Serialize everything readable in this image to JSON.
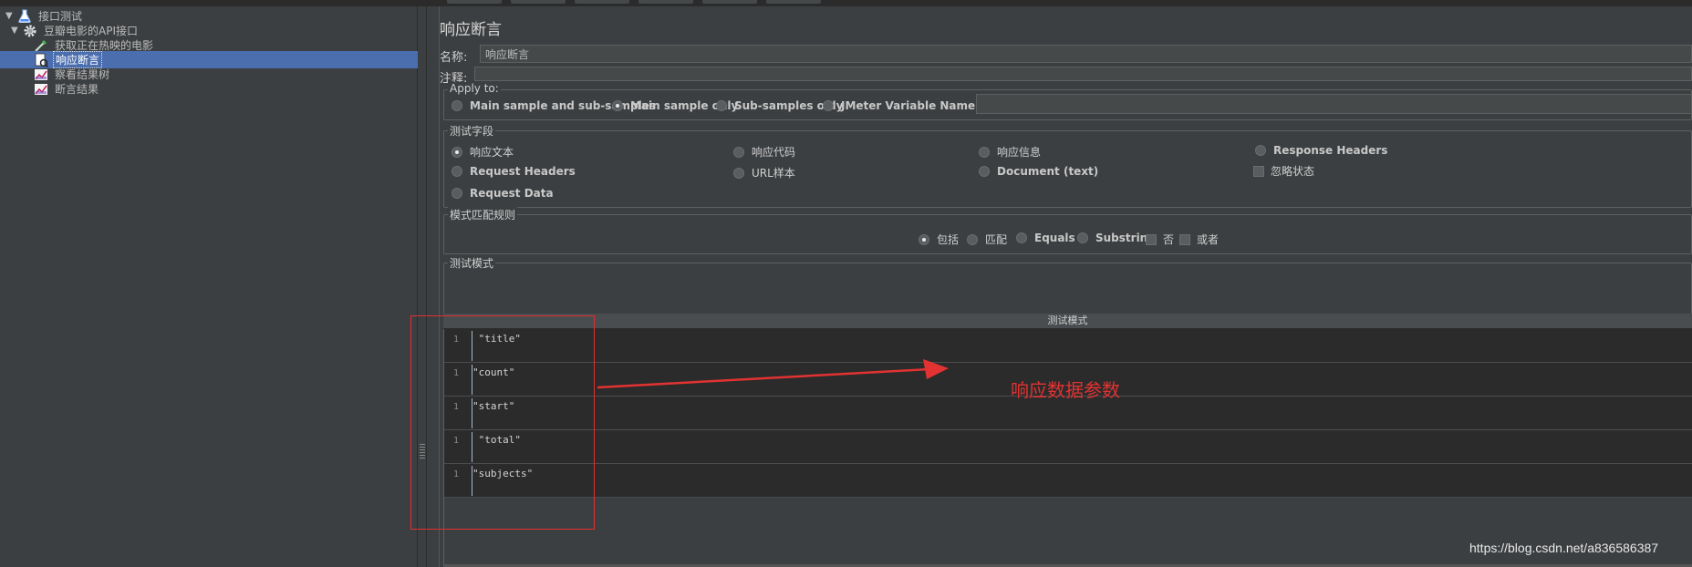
{
  "tree": {
    "items": [
      {
        "label": "接口测试",
        "expanded": true
      },
      {
        "label": "豆瓣电影的API接口",
        "expanded": true
      },
      {
        "label": "获取正在热映的电影"
      },
      {
        "label": "响应断言",
        "selected": true
      },
      {
        "label": "察看结果树"
      },
      {
        "label": "断言结果"
      }
    ]
  },
  "panel": {
    "title": "响应断言",
    "name_label": "名称:",
    "name_value": "响应断言",
    "comment_label": "注释:",
    "comment_value": ""
  },
  "apply_to": {
    "title": "Apply to:",
    "options": [
      "Main sample and sub-samples",
      "Main sample only",
      "Sub-samples only",
      "JMeter Variable Name to use"
    ],
    "selected": "Main sample only",
    "variable_value": ""
  },
  "test_field": {
    "title": "测试字段",
    "options": [
      "响应文本",
      "响应代码",
      "响应信息",
      "Response Headers",
      "Request Headers",
      "URL样本",
      "Document (text)",
      "Request Data"
    ],
    "selected": "响应文本",
    "ignore_status_label": "忽略状态"
  },
  "pattern_rules": {
    "title": "模式匹配规则",
    "options": [
      "包括",
      "匹配",
      "Equals",
      "Substring"
    ],
    "selected": "包括",
    "not_label": "否",
    "or_label": "或者"
  },
  "patterns": {
    "title": "测试模式",
    "column_header": "测试模式",
    "rows": [
      {
        "line": "1",
        "text": " \"title\""
      },
      {
        "line": "1",
        "text": "\"count\""
      },
      {
        "line": "1",
        "text": "\"start\""
      },
      {
        "line": "1",
        "text": " \"total\""
      },
      {
        "line": "1",
        "text": "\"subjects\""
      }
    ]
  },
  "annotation": {
    "text": "响应数据参数",
    "color": "#e23232"
  },
  "watermark": "https://blog.csdn.net/a836586387",
  "colors": {
    "background": "#3c3f41",
    "selection": "#4b6eaf",
    "editor": "#2b2b2b"
  }
}
